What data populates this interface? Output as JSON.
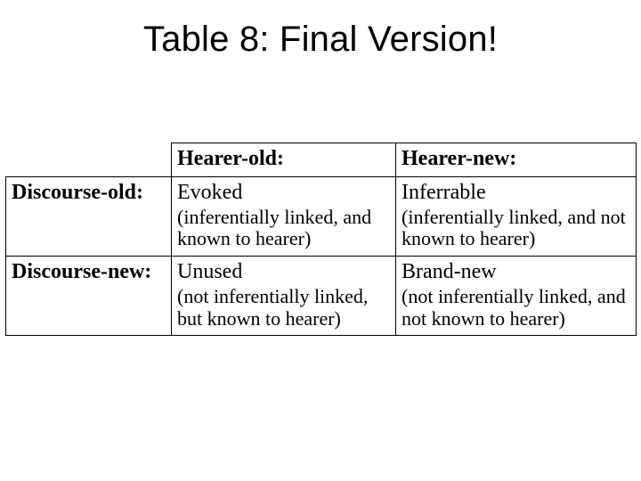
{
  "title": "Table 8: Final Version!",
  "columns": {
    "blank": "",
    "col1": "Hearer-old:",
    "col2": "Hearer-new:"
  },
  "rows": [
    {
      "label": "Discourse-old:",
      "c1_term": "Evoked",
      "c1_sub": "(inferentially linked, and known to hearer)",
      "c2_term": "Inferrable",
      "c2_sub": "(inferentially linked, and not known to hearer)"
    },
    {
      "label": "Discourse-new:",
      "c1_term": "Unused",
      "c1_sub": "(not inferentially linked, but known to hearer)",
      "c2_term": "Brand-new",
      "c2_sub": "(not inferentially linked, and not known to hearer)"
    }
  ]
}
